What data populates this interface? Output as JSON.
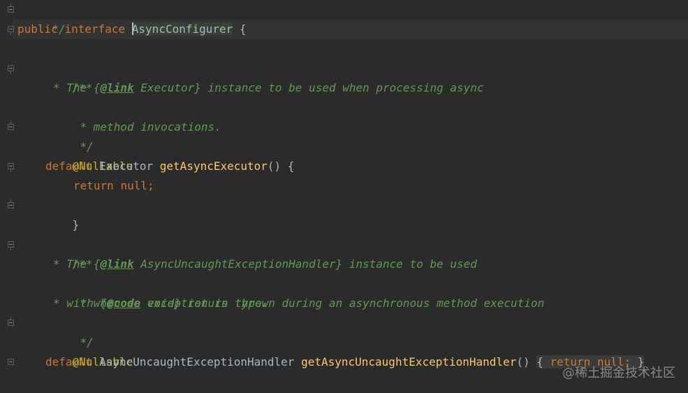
{
  "code": {
    "l1_close": "*/",
    "l2_public": "public",
    "l2_interface": "interface",
    "l2_name": "AsyncConfigurer",
    "l2_brace": "{",
    "doc1_open": "/**",
    "doc1_l1_pre": "* The {",
    "doc1_l1_tag": "@link",
    "doc1_l1_post": " Executor} instance to be used when processing async",
    "doc1_l2": "* method invocations.",
    "doc1_close": "*/",
    "ann1": "@Nullable",
    "m1_default": "default",
    "m1_type": "Executor",
    "m1_name": "getAsyncExecutor",
    "m1_sig": "() {",
    "m1_return": "return",
    "m1_null": "null;",
    "m1_close": "}",
    "doc2_open": "/**",
    "doc2_l1_pre": "* The {",
    "doc2_l1_tag": "@link",
    "doc2_l1_post": " AsyncUncaughtExceptionHandler} instance to be used",
    "doc2_l2": "* when an exception is thrown during an asynchronous method execution",
    "doc2_l3_pre": "* with {",
    "doc2_l3_tag": "@code",
    "doc2_l3_post": " void} return type.",
    "doc2_close": "*/",
    "ann2": "@Nullable",
    "m2_default": "default",
    "m2_type": "AsyncUncaughtExceptionHandler",
    "m2_name": "getAsyncUncaughtExceptionHandler",
    "m2_paren": "()",
    "m2_open": "{",
    "m2_return": "return",
    "m2_null": "null;",
    "m2_close": "}"
  },
  "watermark": "@稀土掘金技术社区",
  "colors": {
    "background": "#2b2b2b",
    "keyword": "#cc7832",
    "annotation": "#bbb529",
    "method": "#ffc66d",
    "doc_comment": "#629755",
    "identifier": "#a9b7c6"
  }
}
